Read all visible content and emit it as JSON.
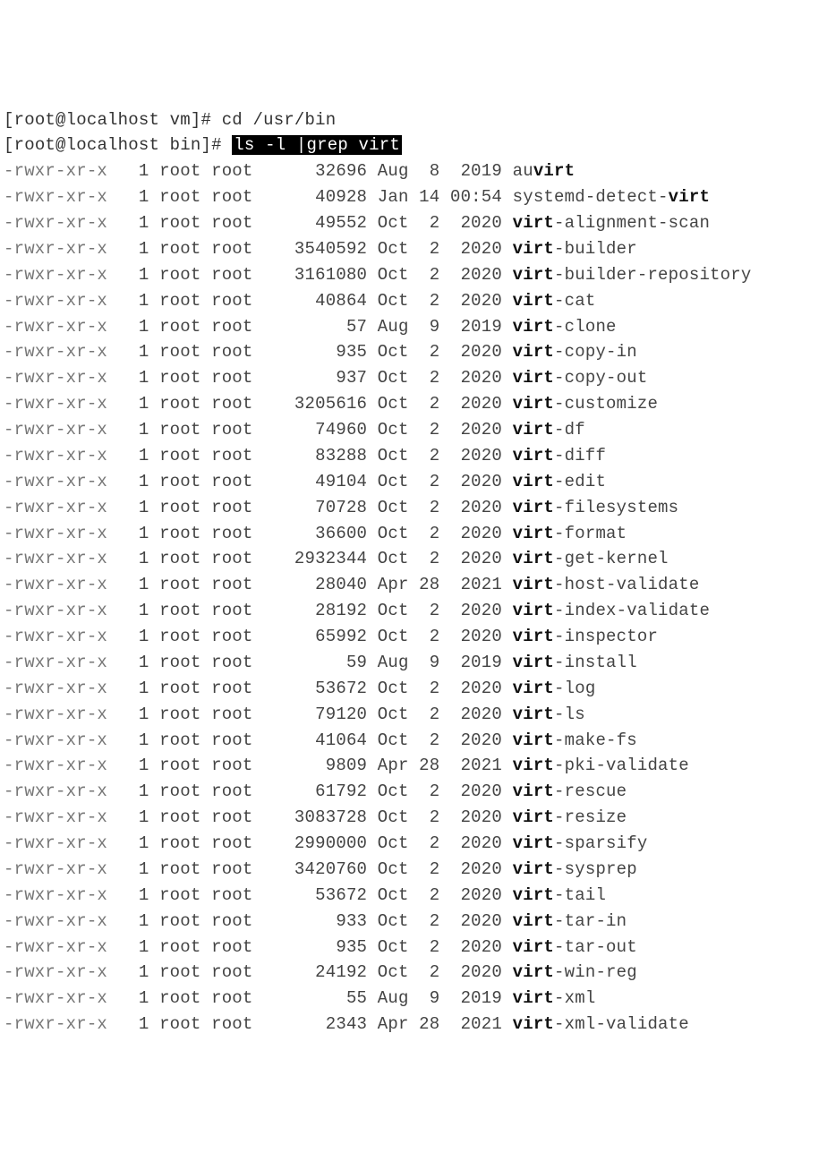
{
  "prompts": [
    {
      "user": "root",
      "host": "localhost",
      "cwd": "vm",
      "cmd": "cd /usr/bin",
      "highlight": false
    },
    {
      "user": "root",
      "host": "localhost",
      "cwd": "bin",
      "cmd": "ls -l |grep virt",
      "highlight": true
    }
  ],
  "match": "virt",
  "listing": [
    {
      "perm": "-rwxr-xr-x",
      "links": "1",
      "owner": "root",
      "group": "root",
      "size": "32696",
      "date": "Aug  8  2019",
      "name": "auvirt"
    },
    {
      "perm": "-rwxr-xr-x",
      "links": "1",
      "owner": "root",
      "group": "root",
      "size": "40928",
      "date": "Jan 14 00:54",
      "name": "systemd-detect-virt"
    },
    {
      "perm": "-rwxr-xr-x",
      "links": "1",
      "owner": "root",
      "group": "root",
      "size": "49552",
      "date": "Oct  2  2020",
      "name": "virt-alignment-scan"
    },
    {
      "perm": "-rwxr-xr-x",
      "links": "1",
      "owner": "root",
      "group": "root",
      "size": "3540592",
      "date": "Oct  2  2020",
      "name": "virt-builder"
    },
    {
      "perm": "-rwxr-xr-x",
      "links": "1",
      "owner": "root",
      "group": "root",
      "size": "3161080",
      "date": "Oct  2  2020",
      "name": "virt-builder-repository"
    },
    {
      "perm": "-rwxr-xr-x",
      "links": "1",
      "owner": "root",
      "group": "root",
      "size": "40864",
      "date": "Oct  2  2020",
      "name": "virt-cat"
    },
    {
      "perm": "-rwxr-xr-x",
      "links": "1",
      "owner": "root",
      "group": "root",
      "size": "57",
      "date": "Aug  9  2019",
      "name": "virt-clone"
    },
    {
      "perm": "-rwxr-xr-x",
      "links": "1",
      "owner": "root",
      "group": "root",
      "size": "935",
      "date": "Oct  2  2020",
      "name": "virt-copy-in"
    },
    {
      "perm": "-rwxr-xr-x",
      "links": "1",
      "owner": "root",
      "group": "root",
      "size": "937",
      "date": "Oct  2  2020",
      "name": "virt-copy-out"
    },
    {
      "perm": "-rwxr-xr-x",
      "links": "1",
      "owner": "root",
      "group": "root",
      "size": "3205616",
      "date": "Oct  2  2020",
      "name": "virt-customize"
    },
    {
      "perm": "-rwxr-xr-x",
      "links": "1",
      "owner": "root",
      "group": "root",
      "size": "74960",
      "date": "Oct  2  2020",
      "name": "virt-df"
    },
    {
      "perm": "-rwxr-xr-x",
      "links": "1",
      "owner": "root",
      "group": "root",
      "size": "83288",
      "date": "Oct  2  2020",
      "name": "virt-diff"
    },
    {
      "perm": "-rwxr-xr-x",
      "links": "1",
      "owner": "root",
      "group": "root",
      "size": "49104",
      "date": "Oct  2  2020",
      "name": "virt-edit"
    },
    {
      "perm": "-rwxr-xr-x",
      "links": "1",
      "owner": "root",
      "group": "root",
      "size": "70728",
      "date": "Oct  2  2020",
      "name": "virt-filesystems"
    },
    {
      "perm": "-rwxr-xr-x",
      "links": "1",
      "owner": "root",
      "group": "root",
      "size": "36600",
      "date": "Oct  2  2020",
      "name": "virt-format"
    },
    {
      "perm": "-rwxr-xr-x",
      "links": "1",
      "owner": "root",
      "group": "root",
      "size": "2932344",
      "date": "Oct  2  2020",
      "name": "virt-get-kernel"
    },
    {
      "perm": "-rwxr-xr-x",
      "links": "1",
      "owner": "root",
      "group": "root",
      "size": "28040",
      "date": "Apr 28  2021",
      "name": "virt-host-validate"
    },
    {
      "perm": "-rwxr-xr-x",
      "links": "1",
      "owner": "root",
      "group": "root",
      "size": "28192",
      "date": "Oct  2  2020",
      "name": "virt-index-validate"
    },
    {
      "perm": "-rwxr-xr-x",
      "links": "1",
      "owner": "root",
      "group": "root",
      "size": "65992",
      "date": "Oct  2  2020",
      "name": "virt-inspector"
    },
    {
      "perm": "-rwxr-xr-x",
      "links": "1",
      "owner": "root",
      "group": "root",
      "size": "59",
      "date": "Aug  9  2019",
      "name": "virt-install"
    },
    {
      "perm": "-rwxr-xr-x",
      "links": "1",
      "owner": "root",
      "group": "root",
      "size": "53672",
      "date": "Oct  2  2020",
      "name": "virt-log"
    },
    {
      "perm": "-rwxr-xr-x",
      "links": "1",
      "owner": "root",
      "group": "root",
      "size": "79120",
      "date": "Oct  2  2020",
      "name": "virt-ls"
    },
    {
      "perm": "-rwxr-xr-x",
      "links": "1",
      "owner": "root",
      "group": "root",
      "size": "41064",
      "date": "Oct  2  2020",
      "name": "virt-make-fs"
    },
    {
      "perm": "-rwxr-xr-x",
      "links": "1",
      "owner": "root",
      "group": "root",
      "size": "9809",
      "date": "Apr 28  2021",
      "name": "virt-pki-validate"
    },
    {
      "perm": "-rwxr-xr-x",
      "links": "1",
      "owner": "root",
      "group": "root",
      "size": "61792",
      "date": "Oct  2  2020",
      "name": "virt-rescue"
    },
    {
      "perm": "-rwxr-xr-x",
      "links": "1",
      "owner": "root",
      "group": "root",
      "size": "3083728",
      "date": "Oct  2  2020",
      "name": "virt-resize"
    },
    {
      "perm": "-rwxr-xr-x",
      "links": "1",
      "owner": "root",
      "group": "root",
      "size": "2990000",
      "date": "Oct  2  2020",
      "name": "virt-sparsify"
    },
    {
      "perm": "-rwxr-xr-x",
      "links": "1",
      "owner": "root",
      "group": "root",
      "size": "3420760",
      "date": "Oct  2  2020",
      "name": "virt-sysprep"
    },
    {
      "perm": "-rwxr-xr-x",
      "links": "1",
      "owner": "root",
      "group": "root",
      "size": "53672",
      "date": "Oct  2  2020",
      "name": "virt-tail"
    },
    {
      "perm": "-rwxr-xr-x",
      "links": "1",
      "owner": "root",
      "group": "root",
      "size": "933",
      "date": "Oct  2  2020",
      "name": "virt-tar-in"
    },
    {
      "perm": "-rwxr-xr-x",
      "links": "1",
      "owner": "root",
      "group": "root",
      "size": "935",
      "date": "Oct  2  2020",
      "name": "virt-tar-out"
    },
    {
      "perm": "-rwxr-xr-x",
      "links": "1",
      "owner": "root",
      "group": "root",
      "size": "24192",
      "date": "Oct  2  2020",
      "name": "virt-win-reg"
    },
    {
      "perm": "-rwxr-xr-x",
      "links": "1",
      "owner": "root",
      "group": "root",
      "size": "55",
      "date": "Aug  9  2019",
      "name": "virt-xml"
    },
    {
      "perm": "-rwxr-xr-x",
      "links": "1",
      "owner": "root",
      "group": "root",
      "size": "2343",
      "date": "Apr 28  2021",
      "name": "virt-xml-validate"
    }
  ]
}
